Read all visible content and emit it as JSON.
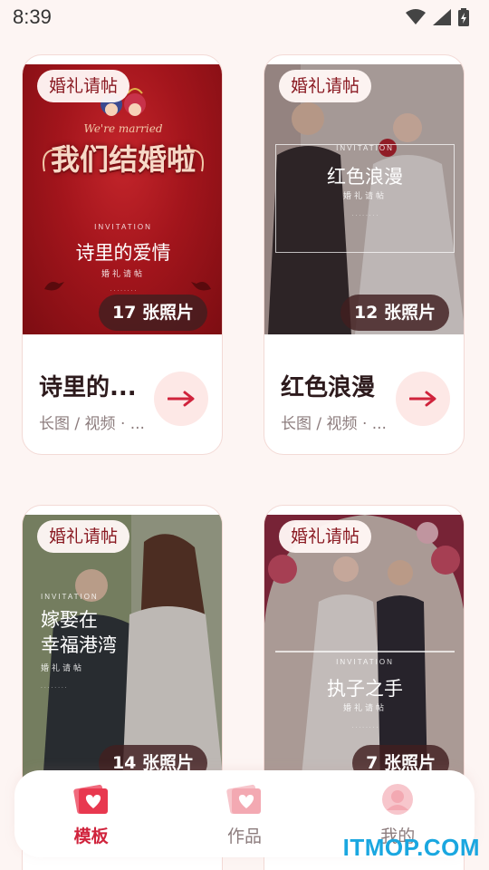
{
  "status_bar": {
    "time": "8:39",
    "icons": [
      "wifi-icon",
      "signal-icon",
      "battery-icon"
    ]
  },
  "cards": [
    {
      "tag": "婚礼请帖",
      "count_label": "17 张照片",
      "title": "诗里的...",
      "meta": "长图 / 视频 · ...",
      "thumb": {
        "married_text": "We're married",
        "big_title": "我们结婚啦",
        "invitation": "INVITATION",
        "headline": "诗里的爱情",
        "sub": "婚礼请帖"
      }
    },
    {
      "tag": "婚礼请帖",
      "count_label": "12 张照片",
      "title": "红色浪漫",
      "meta": "长图 / 视频 · ...",
      "thumb": {
        "invitation": "INVITATION",
        "headline": "红色浪漫",
        "sub": "婚礼请帖"
      }
    },
    {
      "tag": "婚礼请帖",
      "count_label": "14 张照片",
      "thumb": {
        "invitation": "INVITATION",
        "headline_line1": "嫁娶在",
        "headline_line2": "幸福港湾",
        "sub": "婚礼请帖"
      }
    },
    {
      "tag": "婚礼请帖",
      "count_label": "7 张照片",
      "thumb": {
        "invitation": "INVITATION",
        "headline": "执子之手",
        "sub": "婚礼请帖"
      }
    }
  ],
  "bottom_nav": {
    "items": [
      {
        "label": "模板",
        "icon": "template-icon",
        "active": true
      },
      {
        "label": "作品",
        "icon": "works-icon",
        "active": false
      },
      {
        "label": "我的",
        "icon": "profile-icon",
        "active": false
      }
    ]
  },
  "watermark": "ITMOP.COM",
  "colors": {
    "accent": "#d0233c",
    "background": "#fdf5f3",
    "tag_text": "#8a1a22"
  }
}
